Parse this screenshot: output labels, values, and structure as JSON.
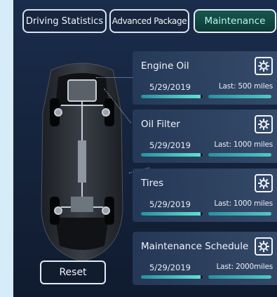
{
  "tabs": [
    {
      "label": "Driving Statistics"
    },
    {
      "label": "Advanced Package"
    },
    {
      "label": "Maintenance"
    }
  ],
  "cards": [
    {
      "title": "Engine Oil",
      "date": "5/29/2019",
      "last": "Last:  500 miles",
      "progress_left": 0.97,
      "progress_right": 1.0
    },
    {
      "title": "Oil Filter",
      "date": "5/29/2019",
      "last": "Last: 1000 miles",
      "progress_left": 0.97,
      "progress_right": 1.0
    },
    {
      "title": "Tires",
      "date": "5/29/2019",
      "last": "Last: 1000 miles",
      "progress_left": 0.97,
      "progress_right": 1.0
    },
    {
      "title": "Maintenance  Schedule",
      "date": "5/29/2019",
      "last": "Last: 2000miles",
      "progress_left": 0.97,
      "progress_right": 1.0
    }
  ],
  "reset_label": "Reset",
  "colors": {
    "accent": "#5fe0d2",
    "background": "#16253f",
    "page": "#d7ecf9"
  }
}
